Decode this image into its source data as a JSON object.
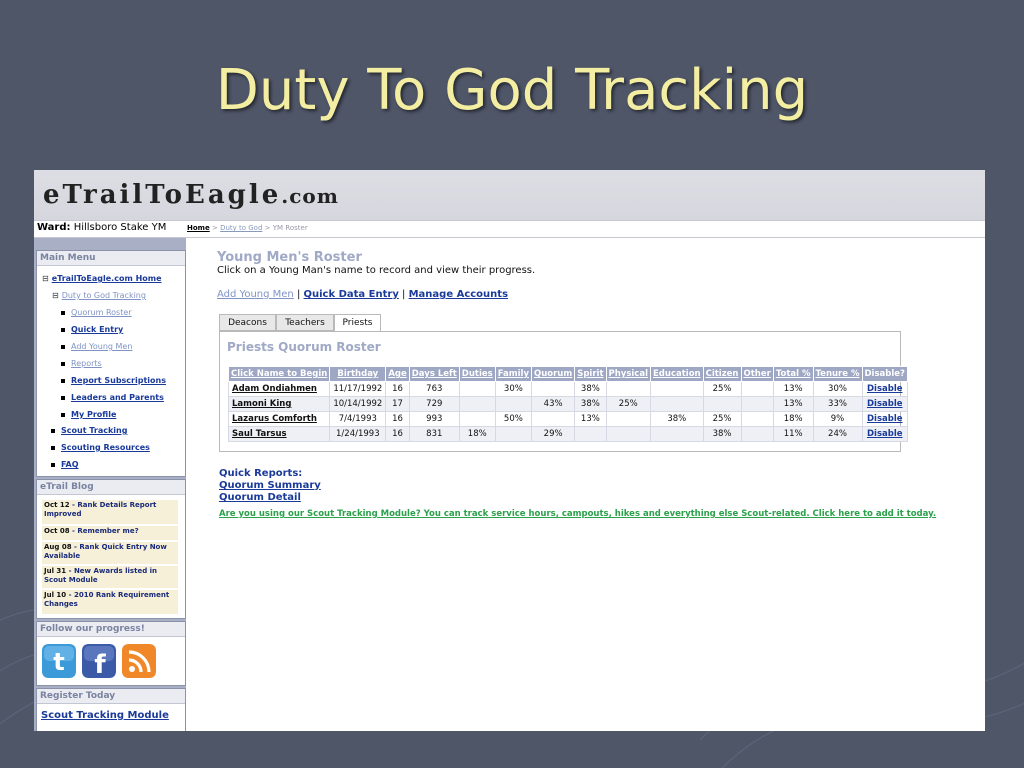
{
  "slide": {
    "title": "Duty To God Tracking"
  },
  "site": {
    "logo_main": "eTrailToEagle",
    "logo_suffix": ".com",
    "ward_label": "Ward:",
    "ward_value": "Hillsboro Stake YM",
    "breadcrumb": {
      "home": "Home",
      "sep1": ">",
      "duty": "Duty to God",
      "sep2": ">",
      "current": "YM Roster"
    }
  },
  "sidebar": {
    "main_menu": {
      "title": "Main Menu",
      "home": "eTrailToEagle.com Home",
      "duty": "Duty to God Tracking",
      "items": [
        {
          "label": "Quorum Roster"
        },
        {
          "label": "Quick Entry"
        },
        {
          "label": "Add Young Men"
        },
        {
          "label": "Reports"
        },
        {
          "label": "Report Subscriptions"
        },
        {
          "label": "Leaders and Parents"
        },
        {
          "label": "My Profile"
        }
      ],
      "scout_tracking": "Scout Tracking",
      "scouting_resources": "Scouting Resources",
      "faq": "FAQ"
    },
    "blog": {
      "title": "eTrail Blog",
      "items": [
        {
          "date": "Oct 12",
          "text": " - Rank Details Report Improved"
        },
        {
          "date": "Oct 08",
          "text": " - Remember me?"
        },
        {
          "date": "Aug 08",
          "text": " - Rank Quick Entry Now Available"
        },
        {
          "date": "Jul 31",
          "text": " - New Awards listed in Scout Module"
        },
        {
          "date": "Jul 10",
          "text": " - 2010 Rank Requirement Changes"
        }
      ]
    },
    "follow": {
      "title": "Follow our progress!"
    },
    "register": {
      "title": "Register Today",
      "link": "Scout Tracking Module"
    }
  },
  "main": {
    "heading": "Young Men's Roster",
    "subheading": "Click on a Young Man's name to record and view their progress.",
    "actions": {
      "add": "Add Young Men",
      "sep1": " | ",
      "quick": "Quick Data Entry",
      "sep2": " | ",
      "manage": "Manage Accounts"
    },
    "tabs": [
      "Deacons",
      "Teachers",
      "Priests"
    ],
    "roster": {
      "title": "Priests Quorum Roster",
      "headers": [
        "Click Name to Begin",
        "Birthday",
        "Age",
        "Days Left",
        "Duties",
        "Family",
        "Quorum",
        "Spirit",
        "Physical",
        "Education",
        "Citizen",
        "Other",
        "Total %",
        "Tenure %",
        "Disable?"
      ],
      "rows": [
        [
          "Adam Ondiahmen",
          "11/17/1992",
          "16",
          "763",
          "",
          "30%",
          "",
          "38%",
          "",
          "",
          "25%",
          "",
          "13%",
          "30%",
          "Disable"
        ],
        [
          "Lamoni King",
          "10/14/1992",
          "17",
          "729",
          "",
          "",
          "43%",
          "38%",
          "25%",
          "",
          "",
          "",
          "13%",
          "33%",
          "Disable"
        ],
        [
          "Lazarus Comforth",
          "7/4/1993",
          "16",
          "993",
          "",
          "50%",
          "",
          "13%",
          "",
          "38%",
          "25%",
          "",
          "18%",
          "9%",
          "Disable"
        ],
        [
          "Saul Tarsus",
          "1/24/1993",
          "16",
          "831",
          "18%",
          "",
          "29%",
          "",
          "",
          "",
          "38%",
          "",
          "11%",
          "24%",
          "Disable"
        ]
      ]
    },
    "quick_reports": {
      "title": "Quick Reports:",
      "summary": "Quorum Summary",
      "detail": "Quorum Detail"
    },
    "promo": "Are you using our Scout Tracking Module? You can track service hours, campouts, hikes and everything else Scout-related. Click here to add it today."
  },
  "colors": {
    "slide_bg": "#4f5668",
    "title_text": "#f3eea2",
    "header_bar": "#9ea7c4",
    "link": "#1a3a9a",
    "promo": "#2aa14a"
  }
}
